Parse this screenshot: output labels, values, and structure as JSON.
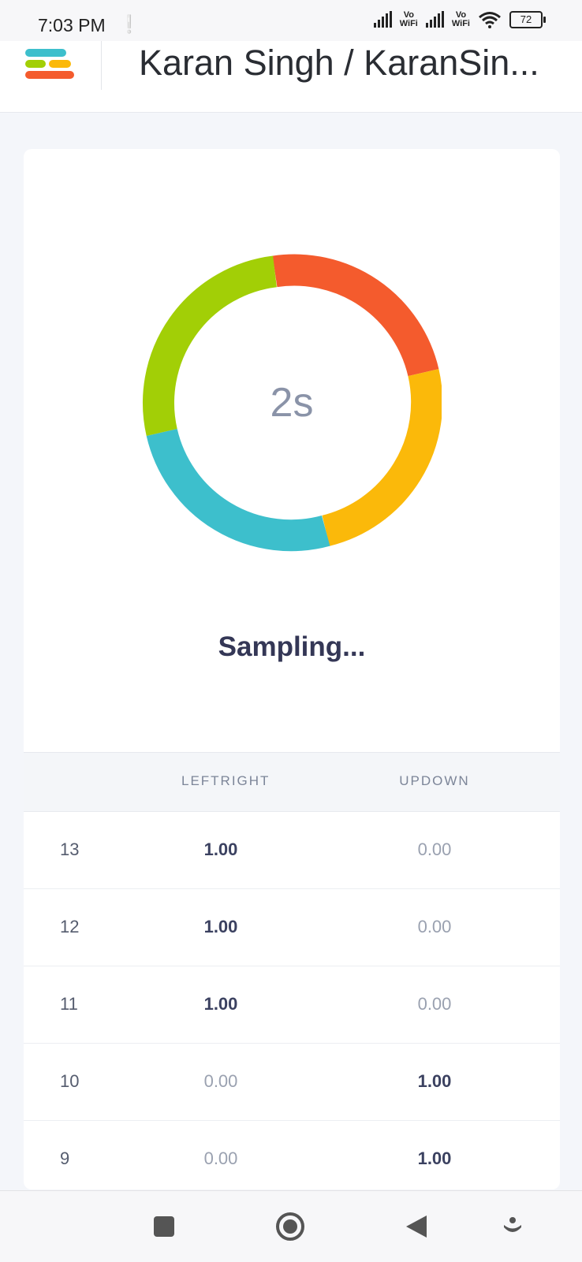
{
  "status_bar": {
    "time": "7:03 PM",
    "extra": "❤",
    "network_1": "Vo\nWiFi",
    "network_2": "Vo\nWiFi",
    "battery": "72"
  },
  "header": {
    "title": "Karan Singh / KaranSin..."
  },
  "sampling": {
    "countdown": "2s",
    "status": "Sampling...",
    "colors": [
      "#f45b2d",
      "#fbb90a",
      "#3dbfcc",
      "#a2cf06"
    ]
  },
  "table": {
    "columns": [
      "",
      "LEFTRIGHT",
      "UPDOWN"
    ],
    "rows": [
      {
        "index": "13",
        "leftright": "1.00",
        "updown": "0.00"
      },
      {
        "index": "12",
        "leftright": "1.00",
        "updown": "0.00"
      },
      {
        "index": "11",
        "leftright": "1.00",
        "updown": "0.00"
      },
      {
        "index": "10",
        "leftright": "0.00",
        "updown": "1.00"
      },
      {
        "index": "9",
        "leftright": "0.00",
        "updown": "1.00"
      }
    ]
  },
  "nav": {
    "icons": [
      "square-icon",
      "home-circle-icon",
      "back-triangle-icon",
      "accessibility-icon"
    ]
  }
}
